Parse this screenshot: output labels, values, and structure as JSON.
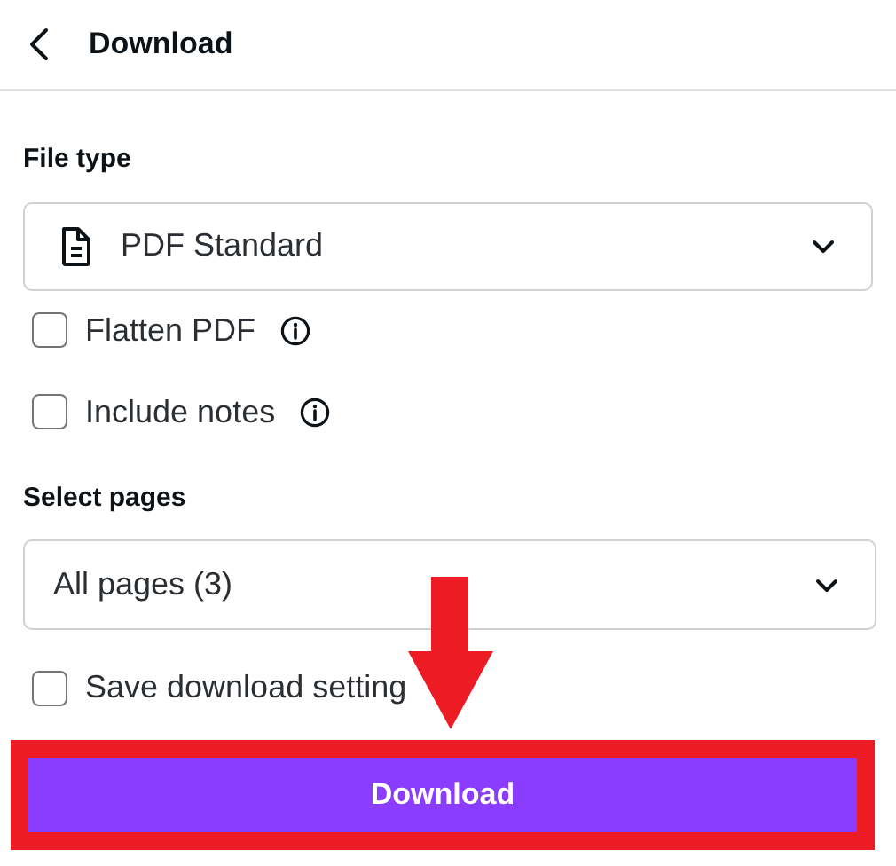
{
  "header": {
    "title": "Download"
  },
  "file_type": {
    "label": "File type",
    "value": "PDF Standard"
  },
  "options": [
    {
      "label": "Flatten PDF",
      "checked": false,
      "info": true
    },
    {
      "label": "Include notes",
      "checked": false,
      "info": true
    }
  ],
  "select_pages": {
    "label": "Select pages",
    "value": "All pages (3)"
  },
  "save_settings": {
    "label": "Save download setting",
    "checked": false
  },
  "download_button": {
    "label": "Download",
    "highlighted": true
  }
}
